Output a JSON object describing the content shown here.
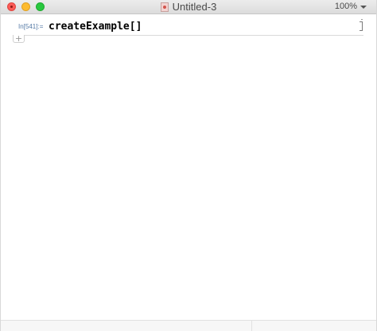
{
  "window": {
    "title": "Untitled-3",
    "zoom": "100%"
  },
  "notebook": {
    "cells": [
      {
        "label": "In[541]:=",
        "code": "createExample[]"
      }
    ]
  }
}
